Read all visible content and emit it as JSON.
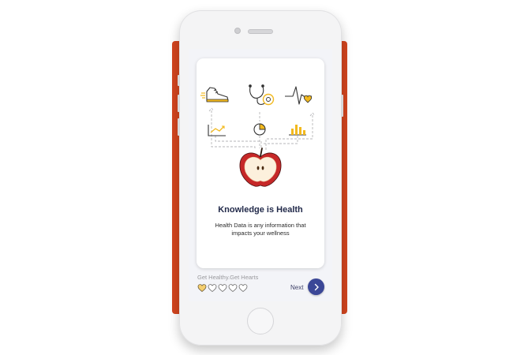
{
  "onboarding": {
    "title": "Knowledge is Health",
    "description": "Health Data is any information that impacts your wellness",
    "icons": [
      "sneaker-icon",
      "stethoscope-icon",
      "heartbeat-icon",
      "trend-chart-icon",
      "pie-chart-icon",
      "bar-chart-icon",
      "apple-icon"
    ]
  },
  "footer": {
    "tagline": "Get Healthy.Get Hearts",
    "hearts_filled": 1,
    "hearts_total": 5,
    "next_label": "Next"
  },
  "colors": {
    "background_panel": "#d2451f",
    "phone_body": "#f4f4f5",
    "accent_yellow": "#f2b91e",
    "apple_red": "#c62828",
    "title_navy": "#222a4a",
    "next_button": "#3b4797"
  }
}
